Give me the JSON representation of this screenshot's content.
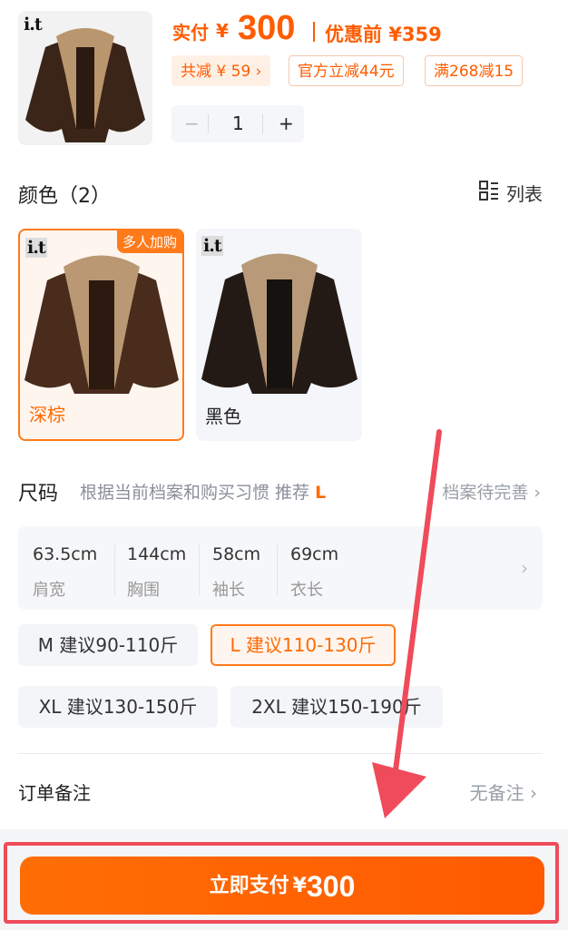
{
  "product": {
    "brand": "i.t",
    "price_label": "实付",
    "currency": "¥",
    "price": "300",
    "original_label": "优惠前",
    "original_price": "¥359",
    "discounts": [
      "共减 ¥ 59 ›",
      "官方立减44元",
      "满268减15"
    ],
    "quantity": "1",
    "minus": "−",
    "plus": "+"
  },
  "color": {
    "title": "颜色（2）",
    "list_label": "列表",
    "options": [
      {
        "name": "深棕",
        "badge": "多人加购",
        "selected": true
      },
      {
        "name": "黑色",
        "selected": false
      }
    ]
  },
  "size": {
    "title": "尺码",
    "hint": "根据当前档案和购买习惯 推荐",
    "recommended": "L",
    "profile_link": "档案待完善 ›",
    "measurements": [
      {
        "value": "63.5cm",
        "label": "肩宽"
      },
      {
        "value": "144cm",
        "label": "胸围"
      },
      {
        "value": "58cm",
        "label": "袖长"
      },
      {
        "value": "69cm",
        "label": "衣长"
      }
    ],
    "options": [
      {
        "label": "M 建议90-110斤"
      },
      {
        "label": "L 建议110-130斤"
      },
      {
        "label": "XL 建议130-150斤"
      },
      {
        "label": "2XL 建议150-190斤"
      }
    ]
  },
  "note": {
    "label": "订单备注",
    "value": "无备注 ›"
  },
  "pay": {
    "label": "立即支付",
    "currency": "¥",
    "amount": "300"
  },
  "colors": {
    "accent": "#ff6a00",
    "highlight_outline": "#ef4b5a"
  }
}
